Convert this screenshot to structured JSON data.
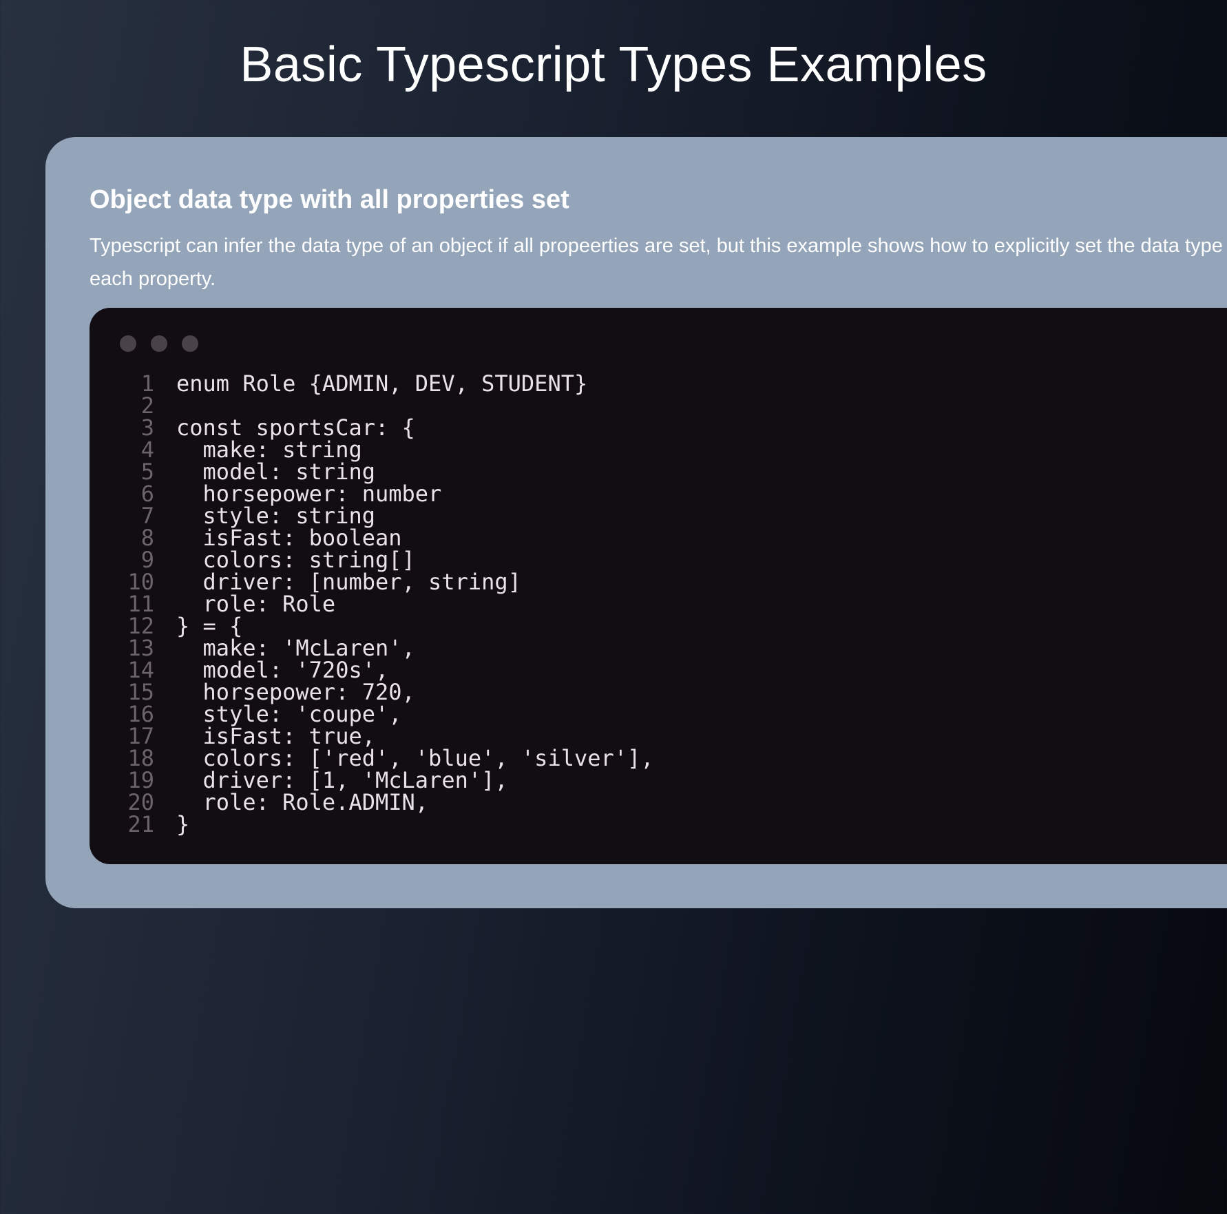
{
  "page": {
    "title": "Basic Typescript Types Examples"
  },
  "card": {
    "heading": "Object data type with all properties set",
    "description": "Typescript can infer the data type of an object if all propeerties are set, but this example shows how to explicitly set the data type of each property."
  },
  "code_window": {
    "window_controls": [
      "dot",
      "dot",
      "dot"
    ],
    "lines": [
      {
        "n": "1",
        "text": "enum Role {ADMIN, DEV, STUDENT}"
      },
      {
        "n": "2",
        "text": ""
      },
      {
        "n": "3",
        "text": "const sportsCar: {"
      },
      {
        "n": "4",
        "text": "  make: string"
      },
      {
        "n": "5",
        "text": "  model: string"
      },
      {
        "n": "6",
        "text": "  horsepower: number"
      },
      {
        "n": "7",
        "text": "  style: string"
      },
      {
        "n": "8",
        "text": "  isFast: boolean"
      },
      {
        "n": "9",
        "text": "  colors: string[]"
      },
      {
        "n": "10",
        "text": "  driver: [number, string]"
      },
      {
        "n": "11",
        "text": "  role: Role"
      },
      {
        "n": "12",
        "text": "} = {"
      },
      {
        "n": "13",
        "text": "  make: 'McLaren',"
      },
      {
        "n": "14",
        "text": "  model: '720s',"
      },
      {
        "n": "15",
        "text": "  horsepower: 720,"
      },
      {
        "n": "16",
        "text": "  style: 'coupe',"
      },
      {
        "n": "17",
        "text": "  isFast: true,"
      },
      {
        "n": "18",
        "text": "  colors: ['red', 'blue', 'silver'],"
      },
      {
        "n": "19",
        "text": "  driver: [1, 'McLaren'],"
      },
      {
        "n": "20",
        "text": "  role: Role.ADMIN,"
      },
      {
        "n": "21",
        "text": "}"
      }
    ]
  },
  "colors": {
    "card_background": "#94a5ba",
    "code_background": "#120c13",
    "line_number": "#6b646a",
    "code_text": "#e9e2e8",
    "window_dot": "#4a4249"
  }
}
